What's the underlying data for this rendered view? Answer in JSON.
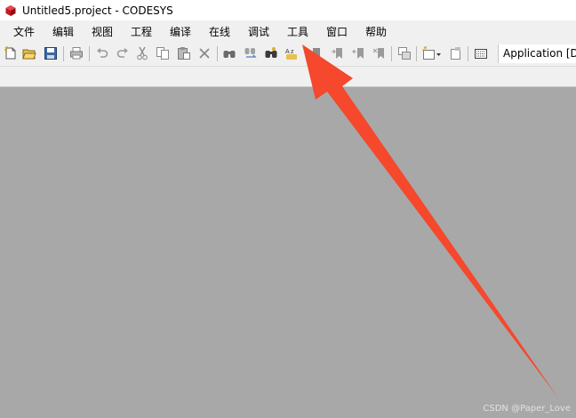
{
  "window": {
    "title": "Untitled5.project - CODESYS",
    "app_icon": "codesys-logo-icon"
  },
  "menu": {
    "items": [
      "文件",
      "编辑",
      "视图",
      "工程",
      "编译",
      "在线",
      "调试",
      "工具",
      "窗口",
      "帮助"
    ]
  },
  "toolbar": {
    "icons": [
      "new-project-icon",
      "open-project-icon",
      "save-project-icon",
      "print-icon",
      "undo-icon",
      "redo-icon",
      "cut-icon",
      "copy-icon",
      "paste-icon",
      "delete-icon",
      "find-icon",
      "find-replace-icon",
      "binoculars-icon",
      "text-replace-icon",
      "bookmark-icon",
      "next-bookmark-icon",
      "previous-bookmark-icon",
      "clear-bookmarks-icon",
      "windows-icon",
      "add-object-icon",
      "properties-icon",
      "build-icon"
    ],
    "application_selector": "Application [D"
  },
  "annotation": {
    "arrow_color": "#f5482d",
    "arrow_target": "工具"
  },
  "watermark": "CSDN @Paper_Love"
}
